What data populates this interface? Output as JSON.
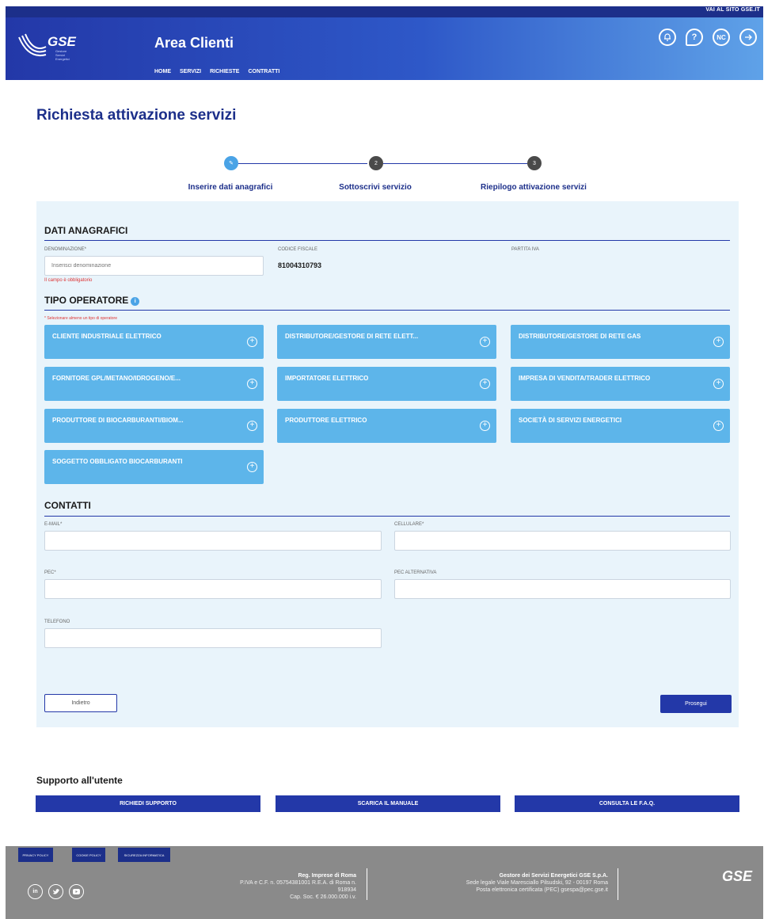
{
  "topbar": {
    "link": "VAI AL SITO GSE.IT"
  },
  "header": {
    "logo": "GSE",
    "logo_sub": "Gestore Servizi Energetici",
    "title": "Area Clienti",
    "nav": [
      "HOME",
      "SERVIZI",
      "RICHIESTE",
      "CONTRATTI"
    ],
    "icons": [
      "bell-icon",
      "help-chat-icon",
      "nc-icon",
      "logout-icon"
    ]
  },
  "page": {
    "title": "Richiesta attivazione servizi"
  },
  "stepper": {
    "steps": [
      {
        "label": "Inserire dati anagrafici",
        "number": "✎",
        "state": "active"
      },
      {
        "label": "Sottoscrivi servizio",
        "number": "2",
        "state": "todo"
      },
      {
        "label": "Riepilogo attivazione servizi",
        "number": "3",
        "state": "todo"
      }
    ]
  },
  "dati": {
    "heading": "DATI ANAGRAFICI",
    "denominazione_label": "DENOMINAZIONE*",
    "denominazione_placeholder": "Inserisci denominazione",
    "denominazione_error": "Il campo è obbligatorio",
    "codice_fiscale_label": "CODICE FISCALE",
    "codice_fiscale_value": "81004310793",
    "partita_iva_label": "PARTITA IVA"
  },
  "operatore": {
    "heading": "TIPO OPERATORE",
    "hint": "* Selezionare almeno un tipo di operatore",
    "cards": [
      "CLIENTE INDUSTRIALE ELETTRICO",
      "DISTRIBUTORE/GESTORE DI RETE ELETT...",
      "DISTRIBUTORE/GESTORE DI RETE GAS",
      "FORNITORE GPL/METANO/IDROGENO/E...",
      "IMPORTATORE ELETTRICO",
      "IMPRESA DI VENDITA/TRADER ELETTRICO",
      "PRODUTTORE DI BIOCARBURANTI/BIOM...",
      "PRODUTTORE ELETTRICO",
      "SOCIETÀ DI SERVIZI ENERGETICI",
      "SOGGETTO OBBLIGATO BIOCARBURANTI"
    ]
  },
  "contatti": {
    "heading": "CONTATTI",
    "email_label": "E-MAIL*",
    "cellulare_label": "CELLULARE*",
    "pec_label": "PEC*",
    "pec_alt_label": "PEC ALTERNATIVA",
    "telefono_label": "TELEFONO"
  },
  "actions": {
    "back": "Indietro",
    "next": "Prosegui"
  },
  "support": {
    "title": "Supporto all'utente",
    "buttons": [
      "RICHIEDI SUPPORTO",
      "SCARICA IL MANUALE",
      "CONSULTA LE F.A.Q."
    ]
  },
  "footer": {
    "badges": [
      "PRIVACY POLICY",
      "COOKIE POLICY",
      "SICUREZZA INFORMATICA"
    ],
    "social": [
      "linkedin-icon",
      "twitter-icon",
      "youtube-icon"
    ],
    "reg_title": "Reg. Imprese di Roma",
    "reg_line1": "P.IVA e C.F. n. 05754381001 R.E.A. di Roma n.",
    "reg_line2": "918934",
    "reg_line3": "Cap. Soc. € 26.000.000 i.v.",
    "company_title": "Gestore dei Servizi Energetici GSE S.p.A.",
    "company_line1": "Sede legale Viale Maresciallo Pilsudski, 92 - 00197 Roma",
    "company_line2": "Posta elettronica certificata (PEC) gsespa@pec.gse.it",
    "logo": "GSE"
  }
}
